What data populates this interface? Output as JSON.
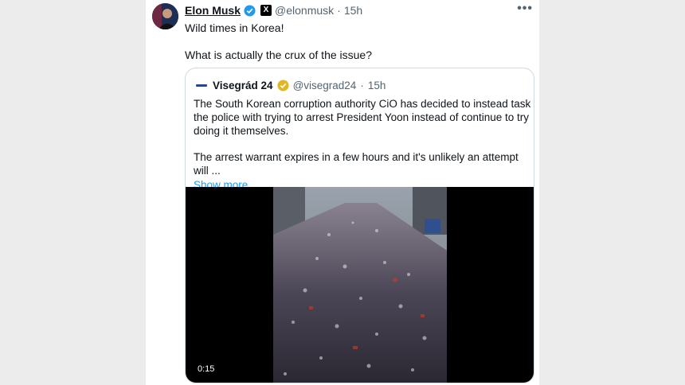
{
  "tweet": {
    "author_name": "Elon Musk",
    "handle": "@elonmusk",
    "separator": "·",
    "time": "15h",
    "more_icon": "more-horizontal-icon",
    "x_badge_label": "X",
    "paragraphs": [
      "Wild times in Korea!",
      "What is actually the crux of the issue?"
    ],
    "verified_color": "#1d9bf0"
  },
  "quote": {
    "author_name": "Visegrád 24",
    "handle": "@visegrad24",
    "separator": "·",
    "time": "15h",
    "verified_color": "#e2b719",
    "paragraphs": [
      "The South Korean corruption authority CiO has decided to instead task the police with trying to arrest President Yoon instead of continue to try doing it themselves.",
      "The arrest warrant expires in a few hours and it's unlikely an attempt will ..."
    ],
    "show_more": "Show more",
    "video": {
      "duration": "0:15"
    }
  }
}
